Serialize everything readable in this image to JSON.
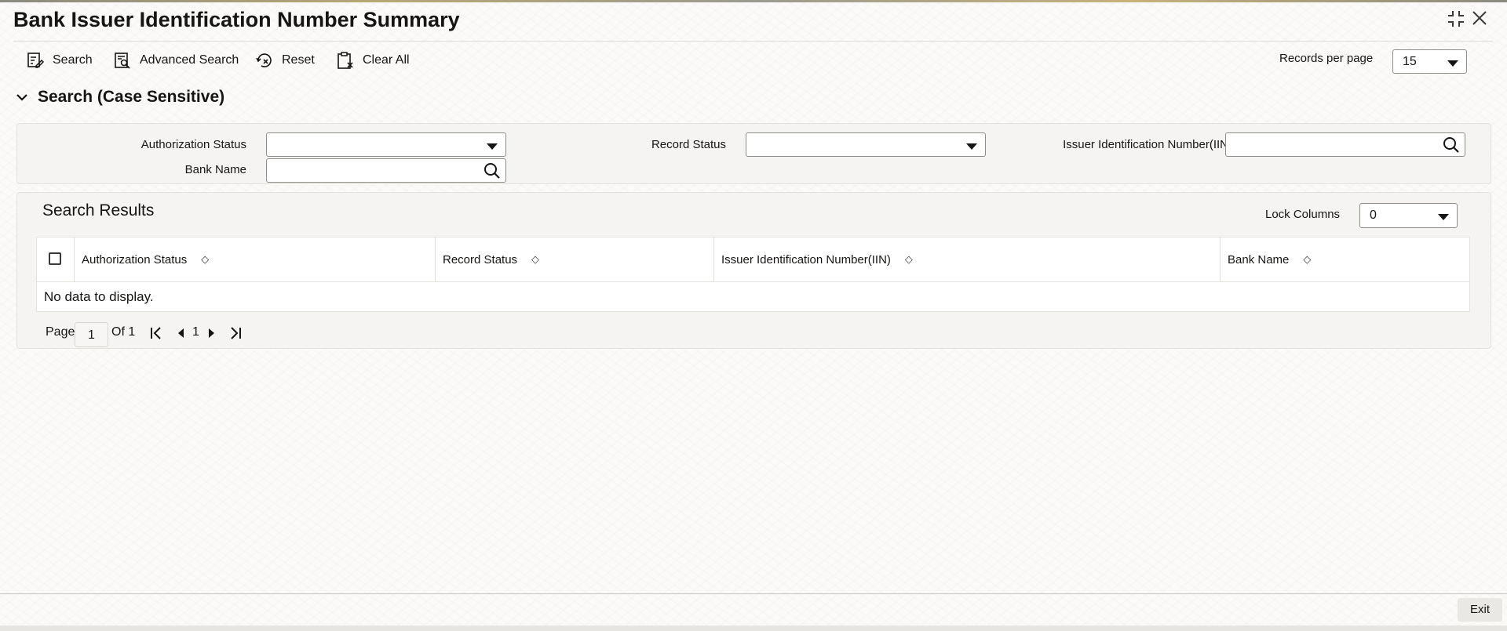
{
  "window": {
    "title": "Bank Issuer Identification Number Summary",
    "maximize_icon": "collapse-corners-icon",
    "close_icon": "close-icon"
  },
  "toolbar": {
    "search_label": "Search",
    "advanced_search_label": "Advanced Search",
    "reset_label": "Reset",
    "clear_all_label": "Clear All",
    "records_per_page_label": "Records per page",
    "records_per_page_value": "15"
  },
  "search_section": {
    "title": "Search (Case Sensitive)",
    "fields": {
      "authorization_status": {
        "label": "Authorization Status",
        "value": ""
      },
      "record_status": {
        "label": "Record Status",
        "value": ""
      },
      "iin": {
        "label": "Issuer Identification Number(IIN)",
        "value": ""
      },
      "bank_name": {
        "label": "Bank Name",
        "value": ""
      }
    }
  },
  "results": {
    "title": "Search Results",
    "lock_columns_label": "Lock Columns",
    "lock_columns_value": "0",
    "columns": [
      "Authorization Status",
      "Record Status",
      "Issuer Identification Number(IIN)",
      "Bank Name"
    ],
    "empty_message": "No data to display."
  },
  "pagination": {
    "page_label": "Page",
    "current_page": "1",
    "of_label": "Of 1",
    "page_number": "1"
  },
  "footer": {
    "exit_label": "Exit"
  }
}
